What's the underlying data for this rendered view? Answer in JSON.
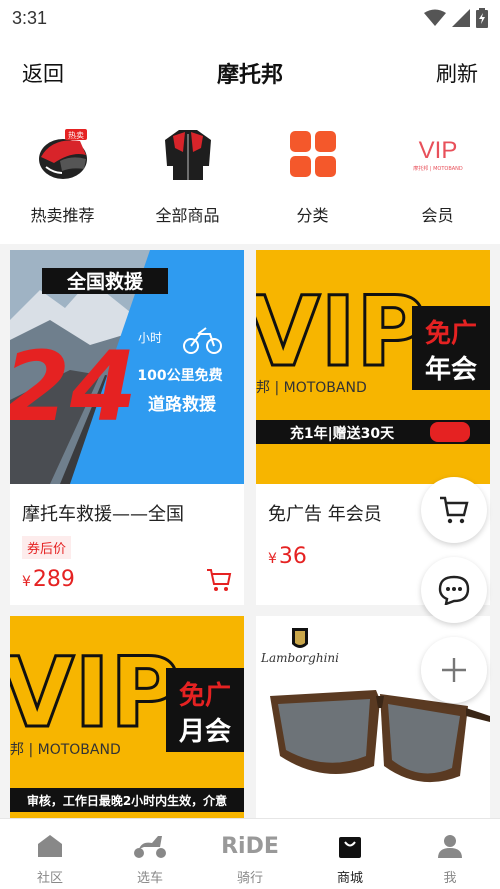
{
  "status_bar": {
    "time": "3:31"
  },
  "nav": {
    "back_label": "返回",
    "title": "摩托邦",
    "refresh_label": "刷新"
  },
  "categories": [
    {
      "label": "热卖推荐",
      "icon": "helmet-icon",
      "badge": "热卖"
    },
    {
      "label": "全部商品",
      "icon": "jacket-icon"
    },
    {
      "label": "分类",
      "icon": "grid-icon"
    },
    {
      "label": "会员",
      "icon": "vip-icon",
      "logo_text": "VIP",
      "logo_sub": "摩托邦 | MOTOBAND"
    }
  ],
  "products": [
    {
      "name": "摩托车救援——全国",
      "coupon": "券后价",
      "currency": "¥",
      "price": "289",
      "banner": {
        "headline": "全国救援",
        "big": "24",
        "unit": "小时",
        "line1": "100公里免费",
        "line2": "道路救援"
      }
    },
    {
      "name": "免广告 年会员",
      "currency": "¥",
      "price": "36",
      "banner": {
        "vip": "VIP",
        "brand": "邦 | MOTOBAND",
        "tag1": "免广",
        "tag2": "年会",
        "strip": "充1年|赠送30天"
      }
    },
    {
      "banner": {
        "vip": "VIP",
        "brand": "邦 | MOTOBAND",
        "tag1": "免广",
        "tag2": "月会",
        "strip": "审核，工作日最晚2小时内生效，介意"
      }
    },
    {
      "banner": {
        "brand": "Lamborghini"
      }
    }
  ],
  "fabs": [
    "cart-icon",
    "chat-icon",
    "plus-icon"
  ],
  "tabbar": [
    {
      "label": "社区",
      "icon": "home-icon"
    },
    {
      "label": "选车",
      "icon": "scooter-icon"
    },
    {
      "label": "骑行",
      "icon": "ride-icon",
      "icon_text": "RiDE"
    },
    {
      "label": "商城",
      "icon": "shopping-bag-icon",
      "active": true
    },
    {
      "label": "我",
      "icon": "person-icon"
    }
  ],
  "colors": {
    "accent_red": "#e52222",
    "yellow": "#f7b500",
    "blue": "#2f9bf0",
    "orange": "#f4582b"
  }
}
